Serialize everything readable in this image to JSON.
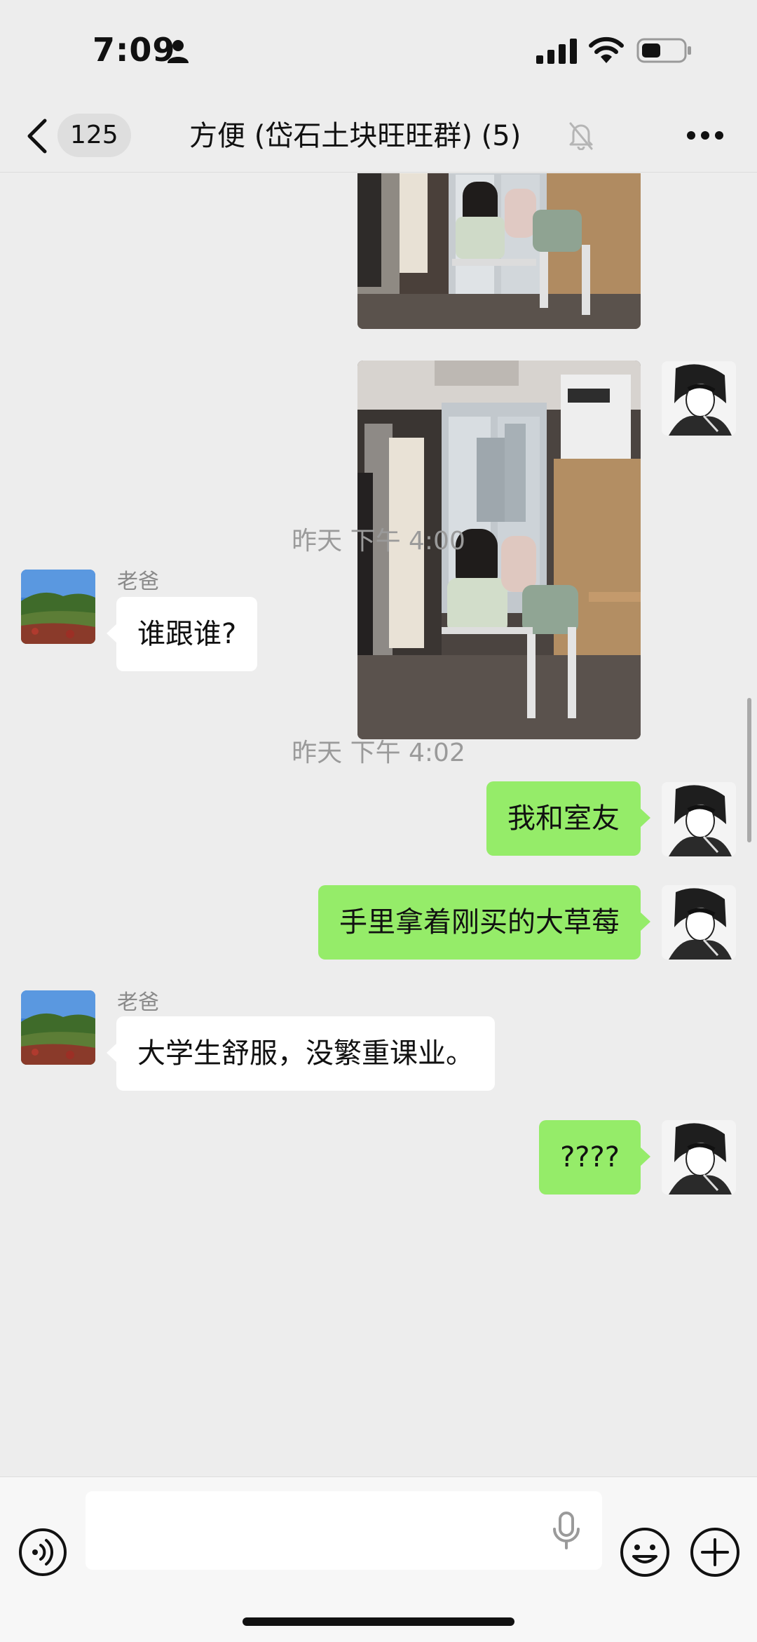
{
  "status_bar": {
    "time": "7:09"
  },
  "nav": {
    "unread_count": "125",
    "title": "方便 (岱石土块旺旺群) (5)"
  },
  "messages": [
    {
      "type": "image",
      "from": "me",
      "subject": "room-photo"
    },
    {
      "type": "image",
      "from": "me",
      "subject": "room-photo"
    },
    {
      "type": "timestamp",
      "text": "昨天 下午 4:00"
    },
    {
      "type": "text",
      "from": "other",
      "sender": "老爸",
      "text": "谁跟谁?"
    },
    {
      "type": "timestamp",
      "text": "昨天 下午 4:02"
    },
    {
      "type": "text",
      "from": "me",
      "text": "我和室友"
    },
    {
      "type": "text",
      "from": "me",
      "text": "手里拿着刚买的大草莓"
    },
    {
      "type": "text",
      "from": "other",
      "sender": "老爸",
      "text": "大学生舒服，没繁重课业。"
    },
    {
      "type": "text",
      "from": "me",
      "text": "????"
    }
  ],
  "icons": {
    "back": "chevron-left-icon",
    "mute": "bell-slash-icon",
    "more": "more-dots-icon",
    "voice": "voice-icon",
    "mic": "microphone-icon",
    "emoji": "emoji-icon",
    "plus": "plus-icon"
  },
  "colors": {
    "background": "#ededed",
    "outgoing_bubble": "#95ec69",
    "incoming_bubble": "#ffffff",
    "timestamp_text": "#9a9a9a"
  }
}
